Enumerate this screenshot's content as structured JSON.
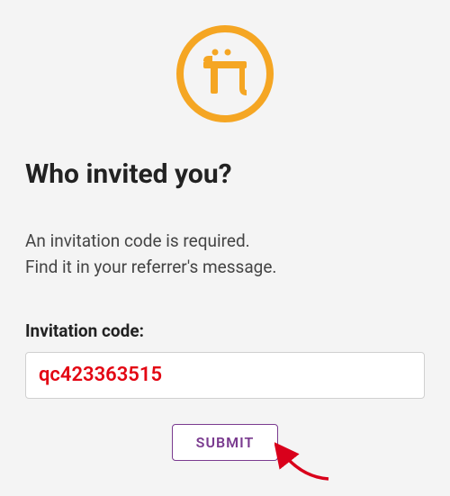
{
  "logo": {
    "name": "pi-logo",
    "color": "#f5a623"
  },
  "heading": "Who invited you?",
  "description_line1": "An invitation code is required.",
  "description_line2": "Find it in your referrer's message.",
  "field": {
    "label": "Invitation code:",
    "value": "qc423363515"
  },
  "submit_label": "SUBMIT",
  "annotation": {
    "arrow_color": "#d9001b"
  }
}
